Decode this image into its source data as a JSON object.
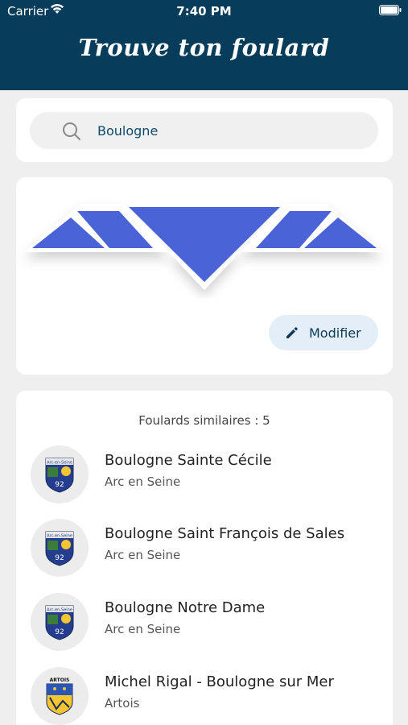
{
  "status_bar": {
    "carrier": "Carrier",
    "time": "7:40 PM"
  },
  "header": {
    "title": "Trouve ton foulard",
    "background_color": "#073d5b"
  },
  "search": {
    "value": "Boulogne",
    "icon": "search-icon"
  },
  "scarf": {
    "main_color": "#4a63d6",
    "border_color": "#ffffff",
    "modify_label": "Modifier",
    "modify_icon": "pencil-icon"
  },
  "similar": {
    "heading": "Foulards similaires : 5",
    "items": [
      {
        "name": "Boulogne Sainte Cécile",
        "group": "Arc en Seine",
        "logo": "arc-en-seine-92-badge"
      },
      {
        "name": "Boulogne Saint François de Sales",
        "group": "Arc en Seine",
        "logo": "arc-en-seine-92-badge"
      },
      {
        "name": "Boulogne Notre Dame",
        "group": "Arc en Seine",
        "logo": "arc-en-seine-92-badge"
      },
      {
        "name": "Michel Rigal - Boulogne sur Mer",
        "group": "Artois",
        "logo": "artois-badge"
      }
    ]
  }
}
